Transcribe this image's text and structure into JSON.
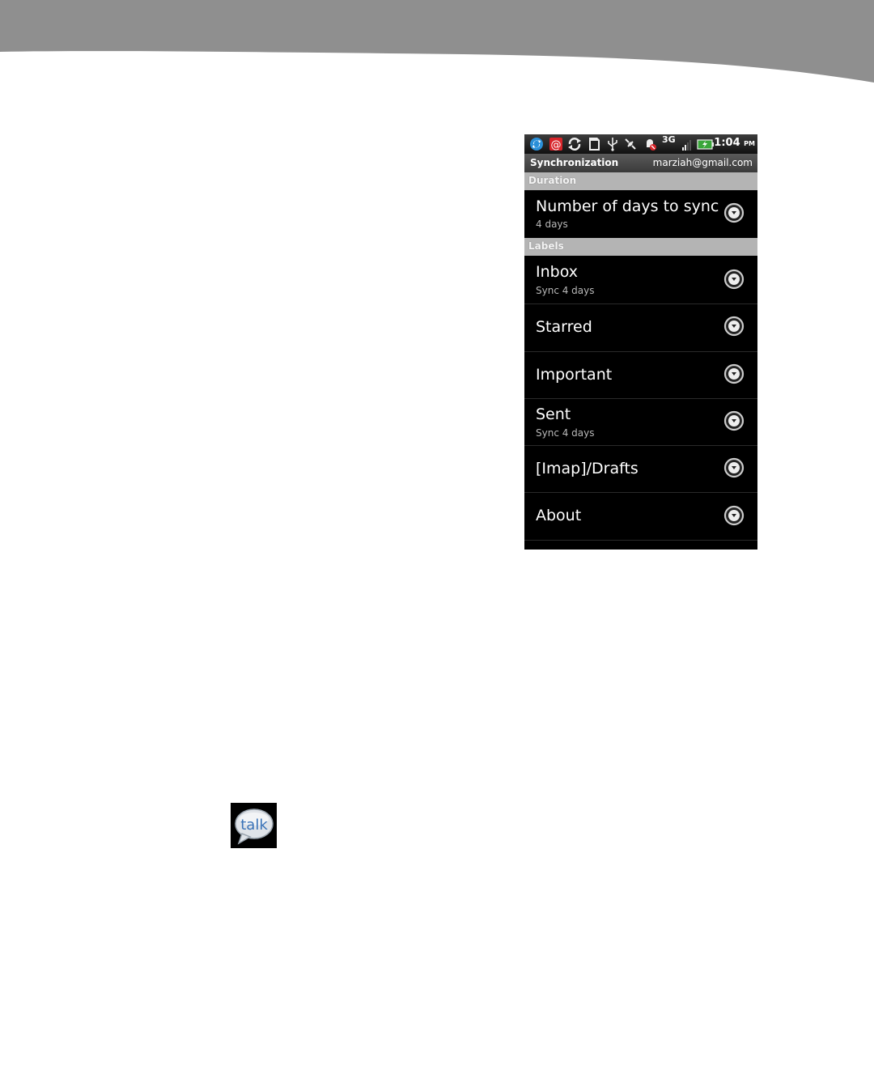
{
  "status_bar": {
    "network": "3G",
    "time": "1:04",
    "ampm": "PM",
    "icons": [
      "sync-icon",
      "email-icon",
      "refresh-icon",
      "sd-card-icon",
      "usb-icon",
      "satellite-icon",
      "alarm-muted-icon",
      "signal-icon",
      "battery-charging-icon"
    ]
  },
  "title_bar": {
    "title": "Synchronization",
    "account": "marziah@gmail.com"
  },
  "sections": {
    "duration": "Duration",
    "labels": "Labels"
  },
  "rows": [
    {
      "label": "Number of days to sync",
      "sub": "4 days"
    },
    {
      "label": "Inbox",
      "sub": "Sync 4 days"
    },
    {
      "label": "Starred",
      "sub": ""
    },
    {
      "label": "Important",
      "sub": ""
    },
    {
      "label": "Sent",
      "sub": "Sync 4 days"
    },
    {
      "label": "[Imap]/Drafts",
      "sub": ""
    },
    {
      "label": "About",
      "sub": ""
    }
  ],
  "talk_icon_text": "talk"
}
